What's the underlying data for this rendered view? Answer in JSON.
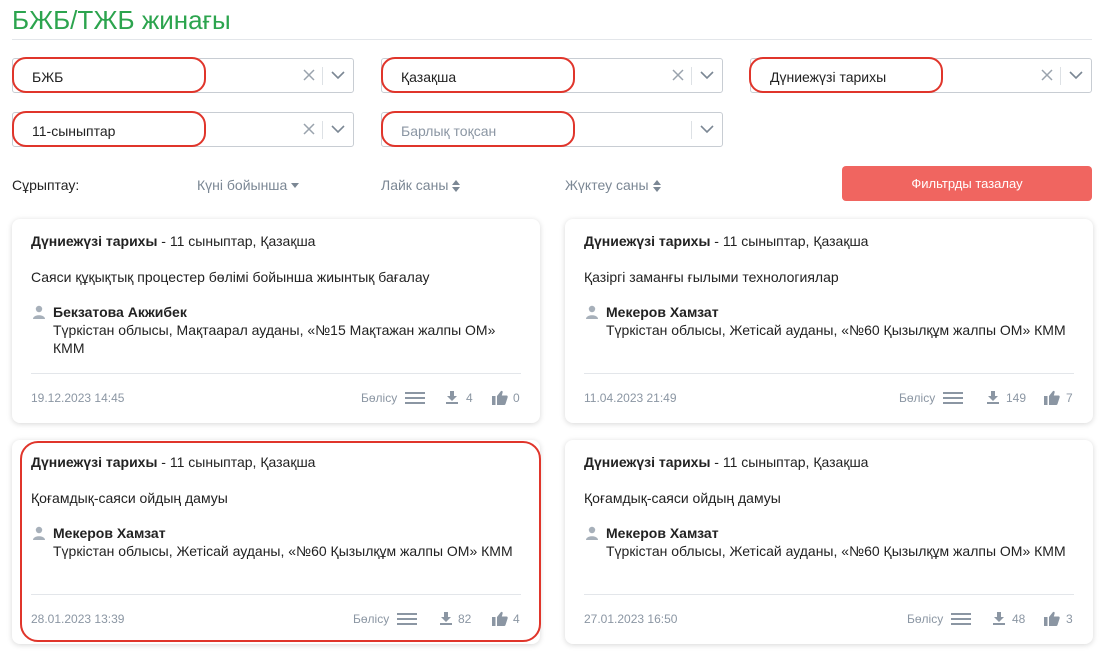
{
  "page": {
    "title": "БЖБ/ТЖБ жинағы"
  },
  "filters": {
    "type": {
      "value": "БЖБ"
    },
    "language": {
      "value": "Қазақша"
    },
    "subject": {
      "value": "Дүниежүзі тарихы"
    },
    "grade": {
      "value": "11-сыныптар"
    },
    "quarter": {
      "placeholder": "Барлық тоқсан"
    }
  },
  "sort": {
    "label": "Сұрыптау:",
    "options": [
      "Күні бойынша",
      "Лайк саны",
      "Жүктеу саны"
    ]
  },
  "clear_button": "Фильтрды тазалау",
  "cards": [
    {
      "subject": "Дүниежүзі тарихы",
      "meta": " - 11 сыныптар, Қазақша",
      "topic": "Саяси құқықтық процестер бөлімі бойынша жиынтық бағалау",
      "author": "Бекзатова Акжибек",
      "org": "Түркістан облысы, Мақтаарал ауданы, «№15 Мақтажан жалпы ОМ» КММ",
      "date": "19.12.2023 14:45",
      "share": "Бөлісу",
      "downloads": "4",
      "likes": "0"
    },
    {
      "subject": "Дүниежүзі тарихы",
      "meta": " - 11 сыныптар, Қазақша",
      "topic": "Қазіргі заманғы ғылыми технологиялар",
      "author": "Мекеров Хамзат",
      "org": "Түркістан облысы, Жетісай ауданы, «№60 Қызылқұм жалпы ОМ» КММ",
      "date": "11.04.2023 21:49",
      "share": "Бөлісу",
      "downloads": "149",
      "likes": "7"
    },
    {
      "subject": "Дүниежүзі тарихы",
      "meta": " - 11 сыныптар, Қазақша",
      "topic": "Қоғамдық-саяси ойдың дамуы",
      "author": "Мекеров Хамзат",
      "org": "Түркістан облысы, Жетісай ауданы, «№60 Қызылқұм жалпы ОМ» КММ",
      "date": "28.01.2023 13:39",
      "share": "Бөлісу",
      "downloads": "82",
      "likes": "4"
    },
    {
      "subject": "Дүниежүзі тарихы",
      "meta": " - 11 сыныптар, Қазақша",
      "topic": "Қоғамдық-саяси ойдың дамуы",
      "author": "Мекеров Хамзат",
      "org": "Түркістан облысы, Жетісай ауданы, «№60 Қызылқұм жалпы ОМ» КММ",
      "date": "27.01.2023 16:50",
      "share": "Бөлісу",
      "downloads": "48",
      "likes": "3"
    }
  ],
  "colors": {
    "title": "#2ca44e",
    "button": "#f06560",
    "highlight": "#e0352b"
  },
  "icons": [
    "clear-icon",
    "chevron-down-icon",
    "sort-desc-icon",
    "sort-both-icon",
    "user-icon",
    "menu-lines-icon",
    "download-icon",
    "thumbs-up-icon"
  ]
}
